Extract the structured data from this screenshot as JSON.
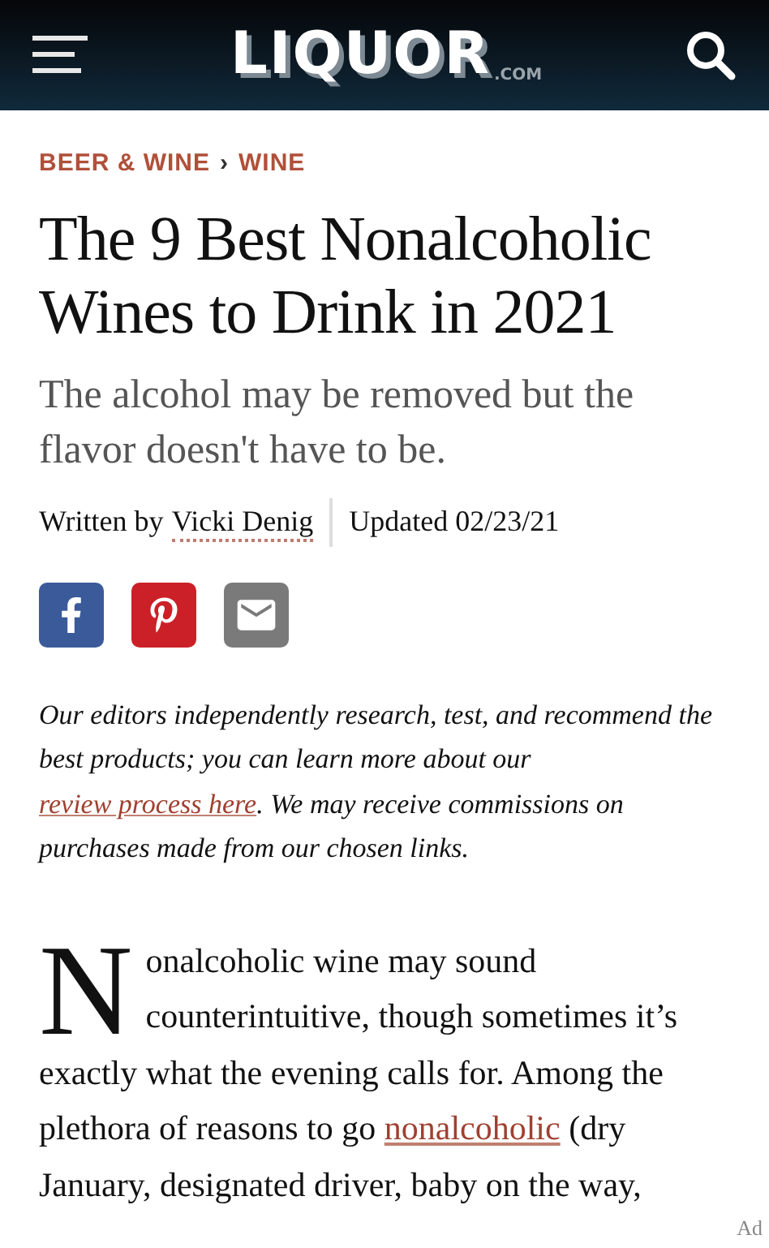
{
  "header": {
    "logo": "LIQUOR",
    "logo_suffix": ".COM"
  },
  "breadcrumbs": [
    {
      "label": "BEER & WINE"
    },
    {
      "label": "WINE"
    }
  ],
  "breadcrumb_separator": "›",
  "title": "The 9 Best Nonalcoholic Wines to Drink in 2021",
  "subtitle": "The alcohol may be removed but the flavor doesn't have to be.",
  "byline": {
    "prefix": "Written by",
    "author": "Vicki Denig",
    "updated": "Updated 02/23/21"
  },
  "share": [
    {
      "kind": "facebook"
    },
    {
      "kind": "pinterest"
    },
    {
      "kind": "email"
    }
  ],
  "disclaimer": {
    "before": "Our editors independently research, test, and recommend the best products; you can learn more about our",
    "link": "review process here",
    "after": ". We may receive commissions on purchases made from our chosen links."
  },
  "intro": {
    "drop_cap": "N",
    "before": "onalcoholic wine may sound counterintuitive, though sometimes it’s exactly what the evening calls for. Among the plethora of reasons to go",
    "link": "nonalcoholic",
    "after": "(dry January, designated driver, baby on the way,"
  },
  "ad_label": "Ad"
}
